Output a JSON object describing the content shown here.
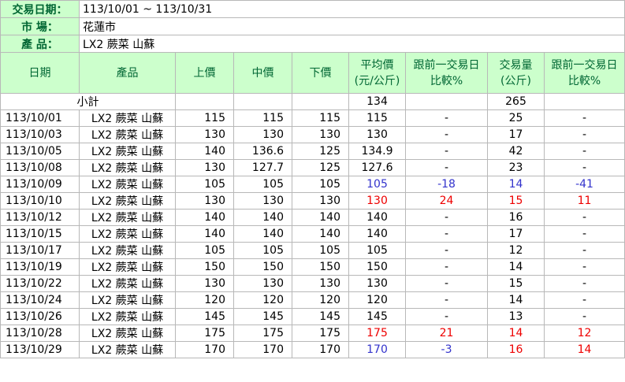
{
  "info": {
    "date_label": "交易日期：",
    "date_value": "113/10/01 ~ 113/10/31",
    "market_label": "市 場：",
    "market_value": "花蓮市",
    "product_label": "產 品：",
    "product_value": "LX2 蕨菜 山蘇"
  },
  "headers": {
    "date": "日期",
    "product": "產品",
    "upper": "上價",
    "middle": "中價",
    "lower": "下價",
    "avg_line1": "平均價",
    "avg_line2": "(元/公斤)",
    "cmp1_line1": "跟前一交易日",
    "cmp1_line2": "比較%",
    "vol_line1": "交易量",
    "vol_line2": "(公斤)",
    "cmp2_line1": "跟前一交易日",
    "cmp2_line2": "比較%"
  },
  "subtotal": {
    "label": "小計",
    "avg": "134",
    "volume": "265"
  },
  "rows": [
    {
      "date": "113/10/01",
      "product": "LX2 蕨菜 山蘇",
      "upper": "115",
      "middle": "115",
      "lower": "115",
      "avg": "115",
      "avg_cmp": "-",
      "volume": "25",
      "vol_cmp": "-"
    },
    {
      "date": "113/10/03",
      "product": "LX2 蕨菜 山蘇",
      "upper": "130",
      "middle": "130",
      "lower": "130",
      "avg": "130",
      "avg_cmp": "-",
      "volume": "17",
      "vol_cmp": "-"
    },
    {
      "date": "113/10/05",
      "product": "LX2 蕨菜 山蘇",
      "upper": "140",
      "middle": "136.6",
      "lower": "125",
      "avg": "134.9",
      "avg_cmp": "-",
      "volume": "42",
      "vol_cmp": "-"
    },
    {
      "date": "113/10/08",
      "product": "LX2 蕨菜 山蘇",
      "upper": "130",
      "middle": "127.7",
      "lower": "125",
      "avg": "127.6",
      "avg_cmp": "-",
      "volume": "23",
      "vol_cmp": "-"
    },
    {
      "date": "113/10/09",
      "product": "LX2 蕨菜 山蘇",
      "upper": "105",
      "middle": "105",
      "lower": "105",
      "avg": "105",
      "avg_cmp": "-18",
      "volume": "14",
      "vol_cmp": "-41",
      "avg_color": "down",
      "vol_color": "down"
    },
    {
      "date": "113/10/10",
      "product": "LX2 蕨菜 山蘇",
      "upper": "130",
      "middle": "130",
      "lower": "130",
      "avg": "130",
      "avg_cmp": "24",
      "volume": "15",
      "vol_cmp": "11",
      "avg_color": "up",
      "vol_color": "up"
    },
    {
      "date": "113/10/12",
      "product": "LX2 蕨菜 山蘇",
      "upper": "140",
      "middle": "140",
      "lower": "140",
      "avg": "140",
      "avg_cmp": "-",
      "volume": "16",
      "vol_cmp": "-"
    },
    {
      "date": "113/10/15",
      "product": "LX2 蕨菜 山蘇",
      "upper": "140",
      "middle": "140",
      "lower": "140",
      "avg": "140",
      "avg_cmp": "-",
      "volume": "17",
      "vol_cmp": "-"
    },
    {
      "date": "113/10/17",
      "product": "LX2 蕨菜 山蘇",
      "upper": "105",
      "middle": "105",
      "lower": "105",
      "avg": "105",
      "avg_cmp": "-",
      "volume": "12",
      "vol_cmp": "-"
    },
    {
      "date": "113/10/19",
      "product": "LX2 蕨菜 山蘇",
      "upper": "150",
      "middle": "150",
      "lower": "150",
      "avg": "150",
      "avg_cmp": "-",
      "volume": "14",
      "vol_cmp": "-"
    },
    {
      "date": "113/10/22",
      "product": "LX2 蕨菜 山蘇",
      "upper": "130",
      "middle": "130",
      "lower": "130",
      "avg": "130",
      "avg_cmp": "-",
      "volume": "15",
      "vol_cmp": "-"
    },
    {
      "date": "113/10/24",
      "product": "LX2 蕨菜 山蘇",
      "upper": "120",
      "middle": "120",
      "lower": "120",
      "avg": "120",
      "avg_cmp": "-",
      "volume": "14",
      "vol_cmp": "-"
    },
    {
      "date": "113/10/26",
      "product": "LX2 蕨菜 山蘇",
      "upper": "145",
      "middle": "145",
      "lower": "145",
      "avg": "145",
      "avg_cmp": "-",
      "volume": "13",
      "vol_cmp": "-"
    },
    {
      "date": "113/10/28",
      "product": "LX2 蕨菜 山蘇",
      "upper": "175",
      "middle": "175",
      "lower": "175",
      "avg": "175",
      "avg_cmp": "21",
      "volume": "14",
      "vol_cmp": "12",
      "avg_color": "up",
      "vol_color": "up"
    },
    {
      "date": "113/10/29",
      "product": "LX2 蕨菜 山蘇",
      "upper": "170",
      "middle": "170",
      "lower": "170",
      "avg": "170",
      "avg_cmp": "-3",
      "volume": "16",
      "vol_cmp": "14",
      "avg_color": "down",
      "vol_color": "up"
    }
  ],
  "colors": {
    "header_bg": "#ccffcc",
    "header_text": "#006633",
    "increase": "#ee0000",
    "decrease": "#3333cc"
  }
}
